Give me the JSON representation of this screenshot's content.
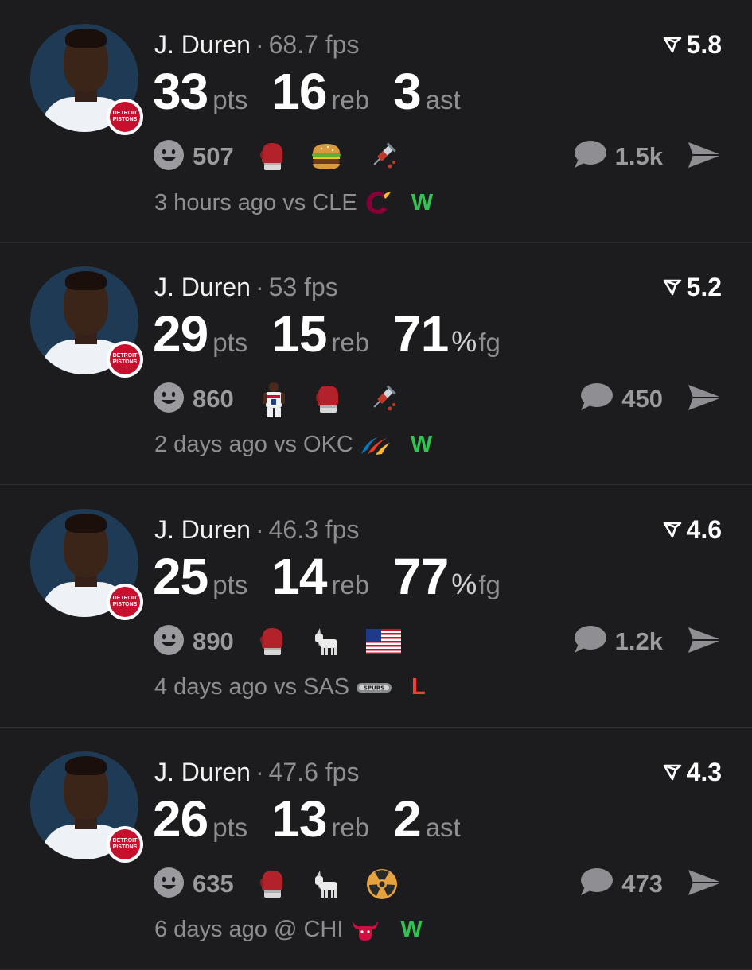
{
  "colors": {
    "win": "#30c553",
    "loss": "#ff3b30",
    "muted": "#8e8e93"
  },
  "cards": [
    {
      "player": "J. Duren",
      "fps": "68.7 fps",
      "rating": "5.8",
      "stats": [
        {
          "value": "33",
          "unit": "pts"
        },
        {
          "value": "16",
          "unit": "reb"
        },
        {
          "value": "3",
          "unit": "ast"
        }
      ],
      "reactions": "507",
      "emojis": [
        "boxing-glove-icon",
        "hamburger-icon",
        "syringe-icon"
      ],
      "comments": "1.5k",
      "time": "3 hours ago",
      "venue": "vs",
      "opponent": "CLE",
      "opponent_logo": "cavaliers-logo-icon",
      "result": "W"
    },
    {
      "player": "J. Duren",
      "fps": "53 fps",
      "rating": "5.2",
      "stats": [
        {
          "value": "29",
          "unit": "pts"
        },
        {
          "value": "15",
          "unit": "reb"
        },
        {
          "value": "71",
          "unit": "fg",
          "pct": "%"
        }
      ],
      "reactions": "860",
      "emojis": [
        "pistons-player-icon",
        "boxing-glove-icon",
        "syringe-icon"
      ],
      "comments": "450",
      "time": "2 days ago",
      "venue": "vs",
      "opponent": "OKC",
      "opponent_logo": "thunder-logo-icon",
      "result": "W"
    },
    {
      "player": "J. Duren",
      "fps": "46.3 fps",
      "rating": "4.6",
      "stats": [
        {
          "value": "25",
          "unit": "pts"
        },
        {
          "value": "14",
          "unit": "reb"
        },
        {
          "value": "77",
          "unit": "fg",
          "pct": "%"
        }
      ],
      "reactions": "890",
      "emojis": [
        "boxing-glove-icon",
        "goat-icon",
        "us-flag-icon"
      ],
      "comments": "1.2k",
      "time": "4 days ago",
      "venue": "vs",
      "opponent": "SAS",
      "opponent_logo": "spurs-logo-icon",
      "result": "L"
    },
    {
      "player": "J. Duren",
      "fps": "47.6 fps",
      "rating": "4.3",
      "stats": [
        {
          "value": "26",
          "unit": "pts"
        },
        {
          "value": "13",
          "unit": "reb"
        },
        {
          "value": "2",
          "unit": "ast"
        }
      ],
      "reactions": "635",
      "emojis": [
        "boxing-glove-icon",
        "goat-icon",
        "radioactive-icon"
      ],
      "comments": "473",
      "time": "6 days ago",
      "venue": "@",
      "opponent": "CHI",
      "opponent_logo": "bulls-logo-icon",
      "result": "W"
    }
  ]
}
